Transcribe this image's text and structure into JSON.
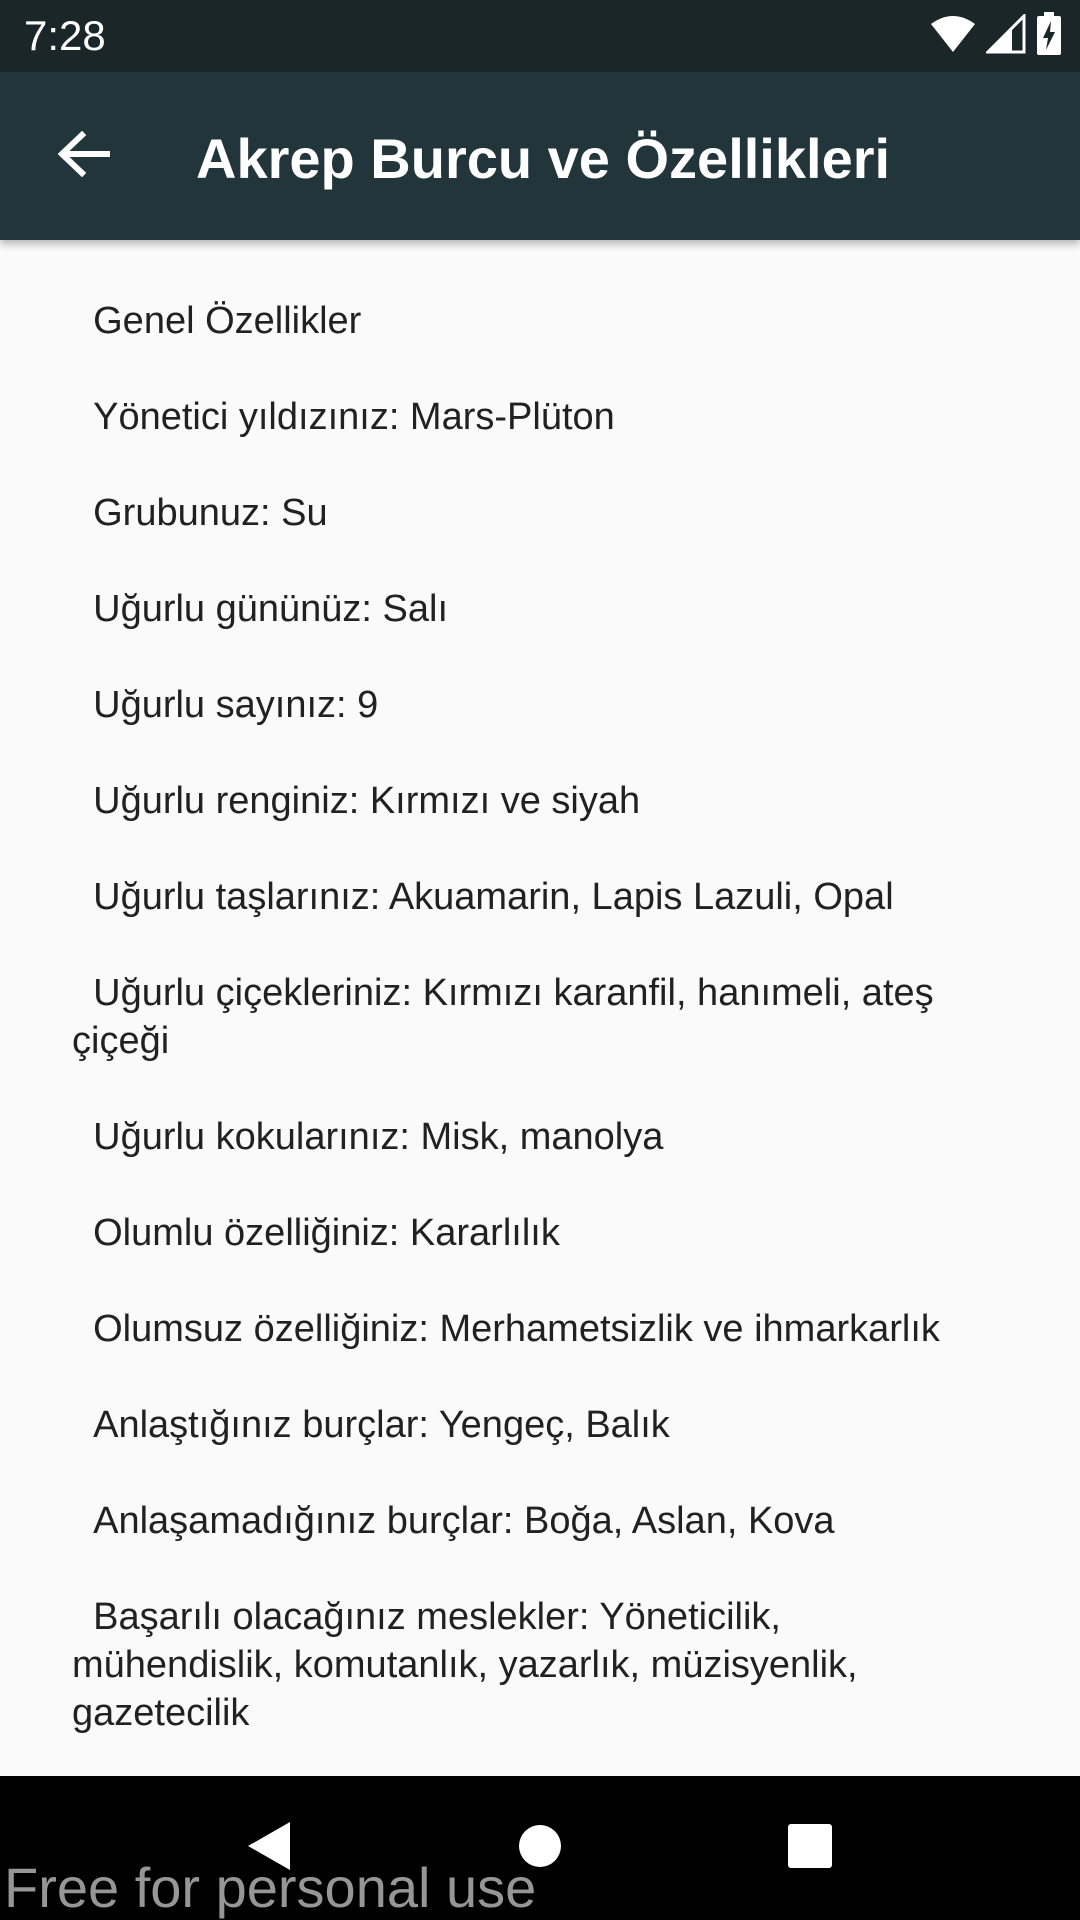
{
  "status_bar": {
    "time": "7:28",
    "icons": [
      "wifi-icon",
      "cell-signal-icon",
      "battery-charging-icon"
    ]
  },
  "app_bar": {
    "back_icon": "arrow-left-icon",
    "title": "Akrep Burcu ve Özellikleri"
  },
  "content": {
    "lines": [
      "  Genel Özellikler",
      "  Yönetici yıldızınız: Mars-Plüton",
      "  Grubunuz: Su",
      "  Uğurlu gününüz: Salı",
      "  Uğurlu sayınız: 9",
      "  Uğurlu renginiz: Kırmızı ve siyah",
      "  Uğurlu taşlarınız: Akuamarin, Lapis Lazuli, Opal",
      "  Uğurlu çiçekleriniz: Kırmızı karanfil, hanımeli, ateş çiçeği",
      "  Uğurlu kokularınız: Misk, manolya",
      "  Olumlu özelliğiniz: Kararlılık",
      "  Olumsuz özelliğiniz: Merhametsizlik ve ihmarkarlık",
      "  Anlaştığınız burçlar: Yengeç, Balık",
      "  Anlaşamadığınız burçlar: Boğa, Aslan, Kova",
      "  Başarılı olacağınız meslekler: Yöneticilik, mühendislik, komutanlık, yazarlık, müzisyenlik, gazetecilik"
    ]
  },
  "nav_bar": {
    "icons": [
      "nav-back-icon",
      "nav-home-icon",
      "nav-recents-icon"
    ]
  },
  "watermark": "Free for personal use",
  "colors": {
    "status_bar_bg": "#1a2628",
    "app_bar_bg": "#22353a",
    "content_bg": "#fafafa",
    "text": "#212121",
    "nav_bar_bg": "#000000"
  }
}
